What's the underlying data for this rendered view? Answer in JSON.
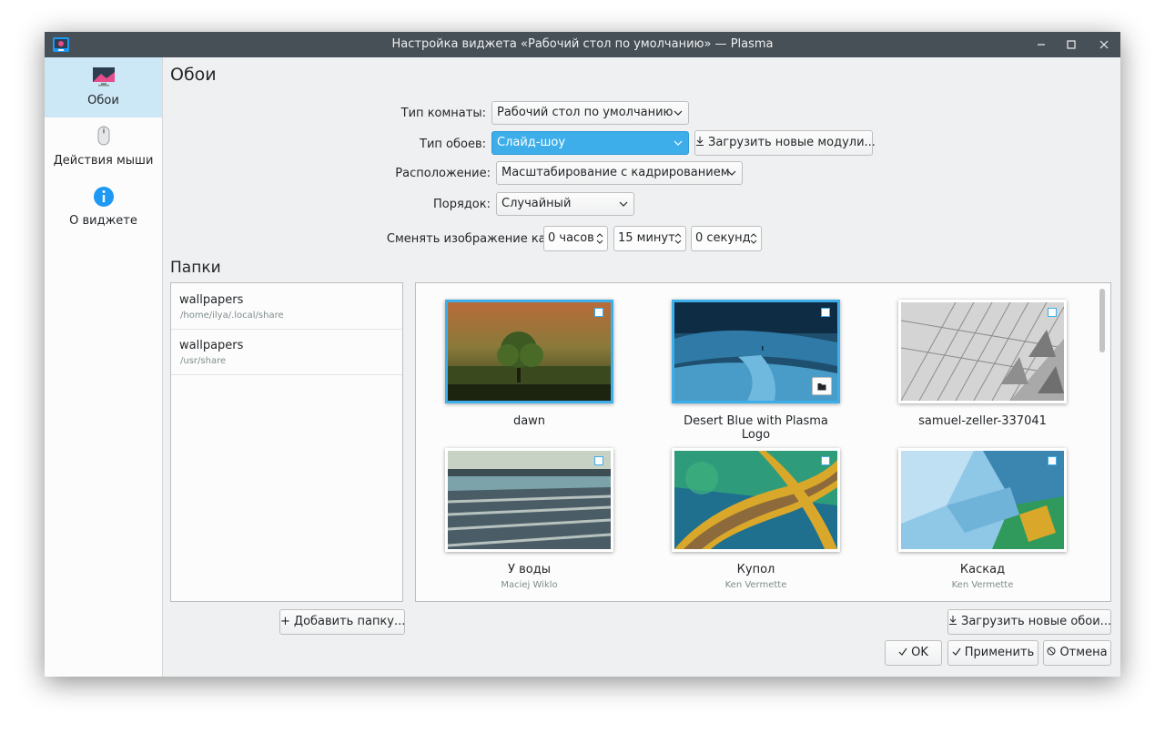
{
  "window": {
    "title": "Настройка виджета «Рабочий стол по умолчанию» — Plasma"
  },
  "sidebar": {
    "items": [
      {
        "label": "Обои",
        "icon": "wallpaper-monitor-icon",
        "active": true
      },
      {
        "label": "Действия мыши",
        "icon": "mouse-icon",
        "active": false
      },
      {
        "label": "О виджете",
        "icon": "info-icon",
        "active": false
      }
    ]
  },
  "page": {
    "title": "Обои",
    "folders_title": "Папки"
  },
  "form": {
    "layout_label": "Тип комнаты:",
    "layout_value": "Рабочий стол по умолчанию",
    "wallpaper_type_label": "Тип обоев:",
    "wallpaper_type_value": "Слайд-шоу",
    "get_plugins_label": "Загрузить новые модули...",
    "positioning_label": "Расположение:",
    "positioning_value": "Масштабирование с кадрированием",
    "order_label": "Порядок:",
    "order_value": "Случайный",
    "interval_label": "Сменять изображение каждые:",
    "hours_value": "0 часов",
    "minutes_value": "15 минут",
    "seconds_value": "0 секунд"
  },
  "folders": [
    {
      "name": "wallpapers",
      "path": "/home/ilya/.local/share"
    },
    {
      "name": "wallpapers",
      "path": "/usr/share"
    }
  ],
  "wallpapers": [
    {
      "name": "dawn",
      "author": "",
      "selected": true
    },
    {
      "name": "Desert Blue with Plasma Logo",
      "author": "",
      "selected": true
    },
    {
      "name": "samuel-zeller-337041",
      "author": "",
      "selected": false
    },
    {
      "name": "У воды",
      "author": "Maciej Wiklo",
      "selected": false
    },
    {
      "name": "Купол",
      "author": "Ken Vermette",
      "selected": false
    },
    {
      "name": "Каскад",
      "author": "Ken Vermette",
      "selected": false
    }
  ],
  "buttons": {
    "add_folder": "Добавить папку...",
    "get_wallpapers": "Загрузить новые обои...",
    "ok": "OK",
    "apply": "Применить",
    "cancel": "Отмена"
  },
  "colors": {
    "accent": "#3daee9",
    "titlebar": "#475057",
    "window_bg": "#eff0f1",
    "sidebar_active": "#cce7f5"
  }
}
